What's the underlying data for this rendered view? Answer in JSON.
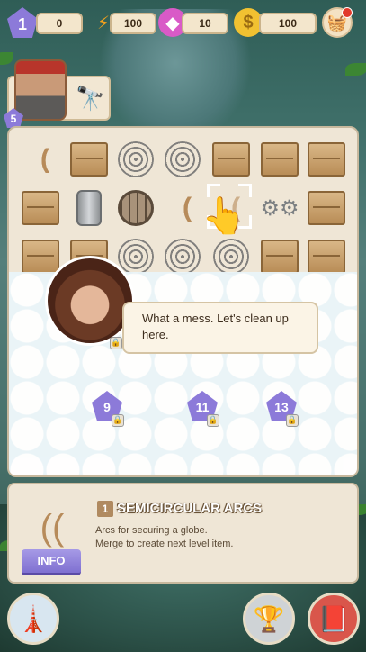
{
  "topbar": {
    "player_level": "1",
    "xp": "0",
    "energy": "100",
    "gems": "10",
    "coins": "100"
  },
  "character": {
    "level": "5"
  },
  "dialogue": {
    "text": "What a mess. Let's clean up here."
  },
  "locked_levels": [
    "9",
    "11",
    "13"
  ],
  "info": {
    "item_level": "1",
    "item_title": "SEMICIRCULAR ARCS",
    "desc_line1": "Arcs for securing a globe.",
    "desc_line2": "Merge to create next level item.",
    "button_label": "INFO"
  },
  "icons": {
    "energy": "lightning-icon",
    "gems": "gem-icon",
    "coins": "coin-icon",
    "shop": "shop-basket-icon"
  },
  "colors": {
    "accent_purple": "#8c7ad9",
    "panel_beige": "#efe6d6"
  }
}
